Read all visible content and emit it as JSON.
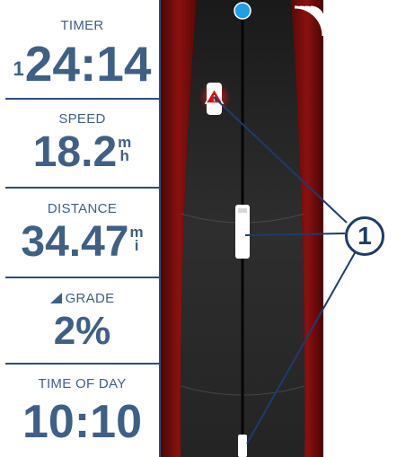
{
  "fields": [
    {
      "label": "TIMER",
      "prefix": "1",
      "value": "24:14",
      "unit_top": "",
      "unit_bottom": ""
    },
    {
      "label": "SPEED",
      "prefix": "",
      "value": "18.2",
      "unit_top": "m",
      "unit_bottom": "h"
    },
    {
      "label": "DISTANCE",
      "prefix": "",
      "value": "34.47",
      "unit_top": "m",
      "unit_bottom": "i"
    },
    {
      "label": "GRADE",
      "prefix": "",
      "value": "2%",
      "unit_top": "",
      "unit_bottom": "",
      "label_icon": "grade-triangle-icon"
    },
    {
      "label": "TIME OF DAY",
      "prefix": "",
      "value": "10:10",
      "unit_top": "",
      "unit_bottom": ""
    }
  ],
  "map": {
    "position_icon": "location-dot-icon",
    "radar_icon": "radar-signal-icon",
    "vehicles": [
      "threat-vehicle-icon",
      "vehicle-icon",
      "vehicle-icon"
    ],
    "road_color": "#2b2b2b",
    "threat_color": "#8b1010",
    "accent_blue": "#1ea0e8"
  },
  "callout": {
    "number": "1",
    "color": "#1d3c6b"
  }
}
